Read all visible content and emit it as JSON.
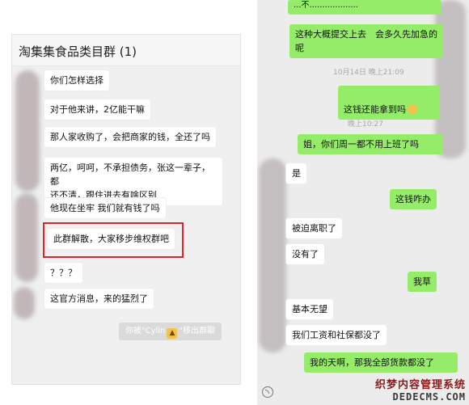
{
  "left_chat": {
    "title": "淘集集食品类目群 (1)",
    "messages": [
      "你们怎样选择",
      "对于他来讲，2亿能干嘛",
      "那人家收购了，会把商家的钱，全还了吗",
      "两亿，呵呵，不承担债务，张这一辈子，都\n还不清，跟住进去有啥区别",
      "他现在坐牢 我们就有钱了吗",
      "此群解散，大家移步维权群吧",
      "？？？",
      "这官方消息，来的猛烈了"
    ],
    "system_notice": {
      "prefix": "你被\"Cylin",
      "suffix": "\"移出群聊",
      "icon": "tiger-emoji-icon"
    },
    "highlight_color": "#d9252b"
  },
  "right_chat": {
    "messages": [
      {
        "side": "right",
        "text": "...不..................."
      },
      {
        "side": "right",
        "text": "这种大概提交上去　会多久先加急的\n呢"
      },
      {
        "side": "time",
        "text": "10月14日 晚上21:09"
      },
      {
        "side": "right",
        "text": "这钱还能拿到吗",
        "emoji": "smile-emoji-icon"
      },
      {
        "side": "time",
        "text": "晚上10:27"
      },
      {
        "side": "right",
        "text": "姐，你们周一都不用上班了吗"
      },
      {
        "side": "left",
        "text": "是"
      },
      {
        "side": "right",
        "text": "这钱咋办"
      },
      {
        "side": "left",
        "text": "被迫离职了"
      },
      {
        "side": "left",
        "text": "没有了"
      },
      {
        "side": "right",
        "text": "我草"
      },
      {
        "side": "left",
        "text": "基本无望"
      },
      {
        "side": "left",
        "text": "我们工资和社保都没了"
      },
      {
        "side": "right",
        "text": "我的天啊，那我全部货款都没了"
      }
    ],
    "watermark": {
      "line1": "织梦内容管理系统",
      "line2": "DEDECMS.COM"
    },
    "colors": {
      "sent_bubble": "#95ec69",
      "received_bubble": "#ffffff",
      "background": "#ececec"
    }
  }
}
